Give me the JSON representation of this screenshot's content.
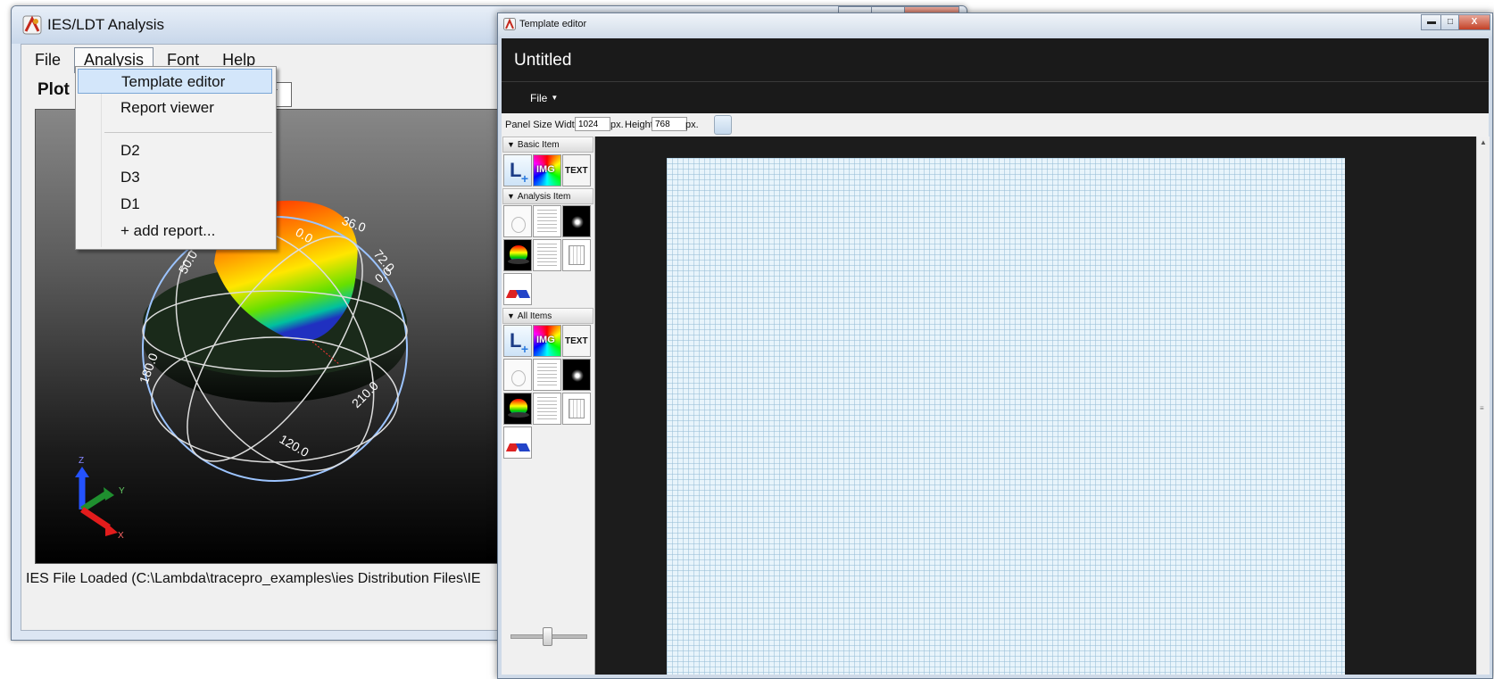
{
  "analysis_window": {
    "title": "IES/LDT Analysis",
    "menu": [
      "File",
      "Analysis",
      "Font",
      "Help"
    ],
    "plot_label": "Plot",
    "status": "IES File Loaded (C:\\Lambda\\tracepro_examples\\ies Distribution Files\\IE",
    "dropdown": {
      "items": [
        "Template editor",
        "Report viewer",
        "D2",
        "D3",
        "D1",
        "+ add report..."
      ],
      "highlighted": "Template editor"
    },
    "plot3d": {
      "labels": [
        "36.0",
        "72.0",
        "0.0",
        "0.0",
        "50.0",
        "180.0",
        "210.0",
        "120.0"
      ],
      "axes": [
        "Z",
        "Y",
        "X"
      ]
    }
  },
  "template_editor": {
    "title": "Template editor",
    "doc_title": "Untitled",
    "file_menu": "File",
    "window_buttons": {
      "minimize": "▬",
      "maximize": "□",
      "close": "X"
    },
    "panel_size": {
      "label_width": "Panel Size Width:",
      "width": "1024",
      "unit": "px.",
      "label_height": "Height:",
      "height": "768",
      "unit2": "px."
    },
    "palette": {
      "sections": [
        "Basic Item",
        "Analysis Item",
        "All Items"
      ],
      "tiles": {
        "l": "L",
        "img": "IMG",
        "text": "TEXT"
      }
    },
    "colors": {
      "dark_header": "#1a1a1a",
      "grid_page": "#e8f4fb"
    }
  }
}
